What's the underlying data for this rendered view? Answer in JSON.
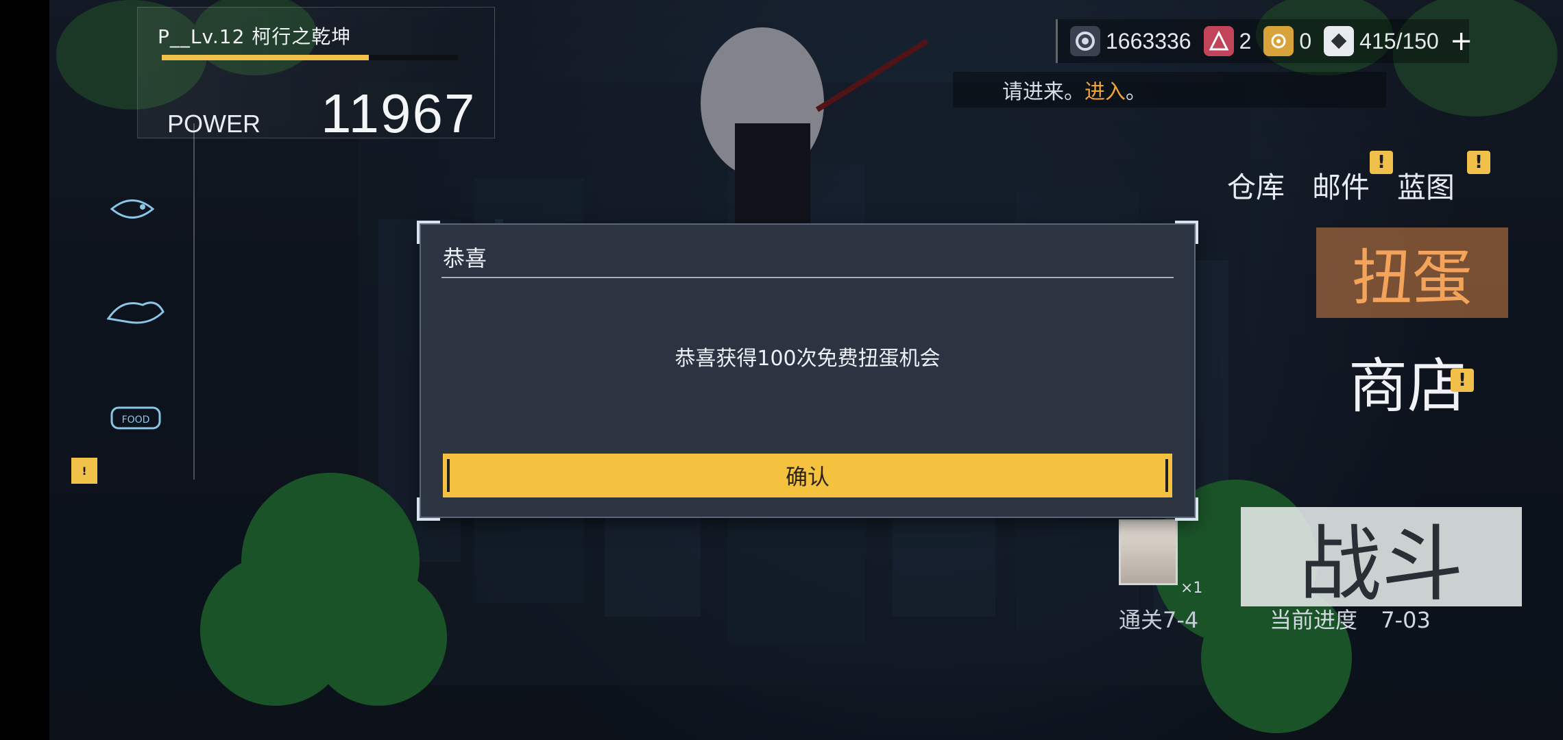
{
  "player": {
    "name": "P__Lv.12 柯行之乾坤",
    "power_label": "POWER",
    "power_value": "11967",
    "exp_fraction": 0.7
  },
  "currencies": [
    {
      "icon": "gear-currency-icon",
      "value": "1663336"
    },
    {
      "icon": "red-triangle-icon",
      "value": "2"
    },
    {
      "icon": "yellow-cog-icon",
      "value": "0"
    },
    {
      "icon": "stamina-icon",
      "value": "415/150"
    }
  ],
  "plus_label": "+",
  "notice": {
    "text": "请进来。",
    "action": "进入",
    "trail": "。"
  },
  "menu": {
    "warehouse": "仓库",
    "mail": "邮件",
    "blueprint": "蓝图",
    "gacha": "扭蛋",
    "shop": "商店",
    "battle": "战斗",
    "clear_label": "通关7-4",
    "progress_label": "当前进度",
    "progress_value": "7-03",
    "avatar_count": "×1",
    "badge": "!"
  },
  "modal": {
    "title": "恭喜",
    "message": "恭喜获得100次免费扭蛋机会",
    "confirm": "确认"
  },
  "colors": {
    "accent": "#f5c23f",
    "orange": "#f0a23c",
    "panel": "#2c3442"
  }
}
